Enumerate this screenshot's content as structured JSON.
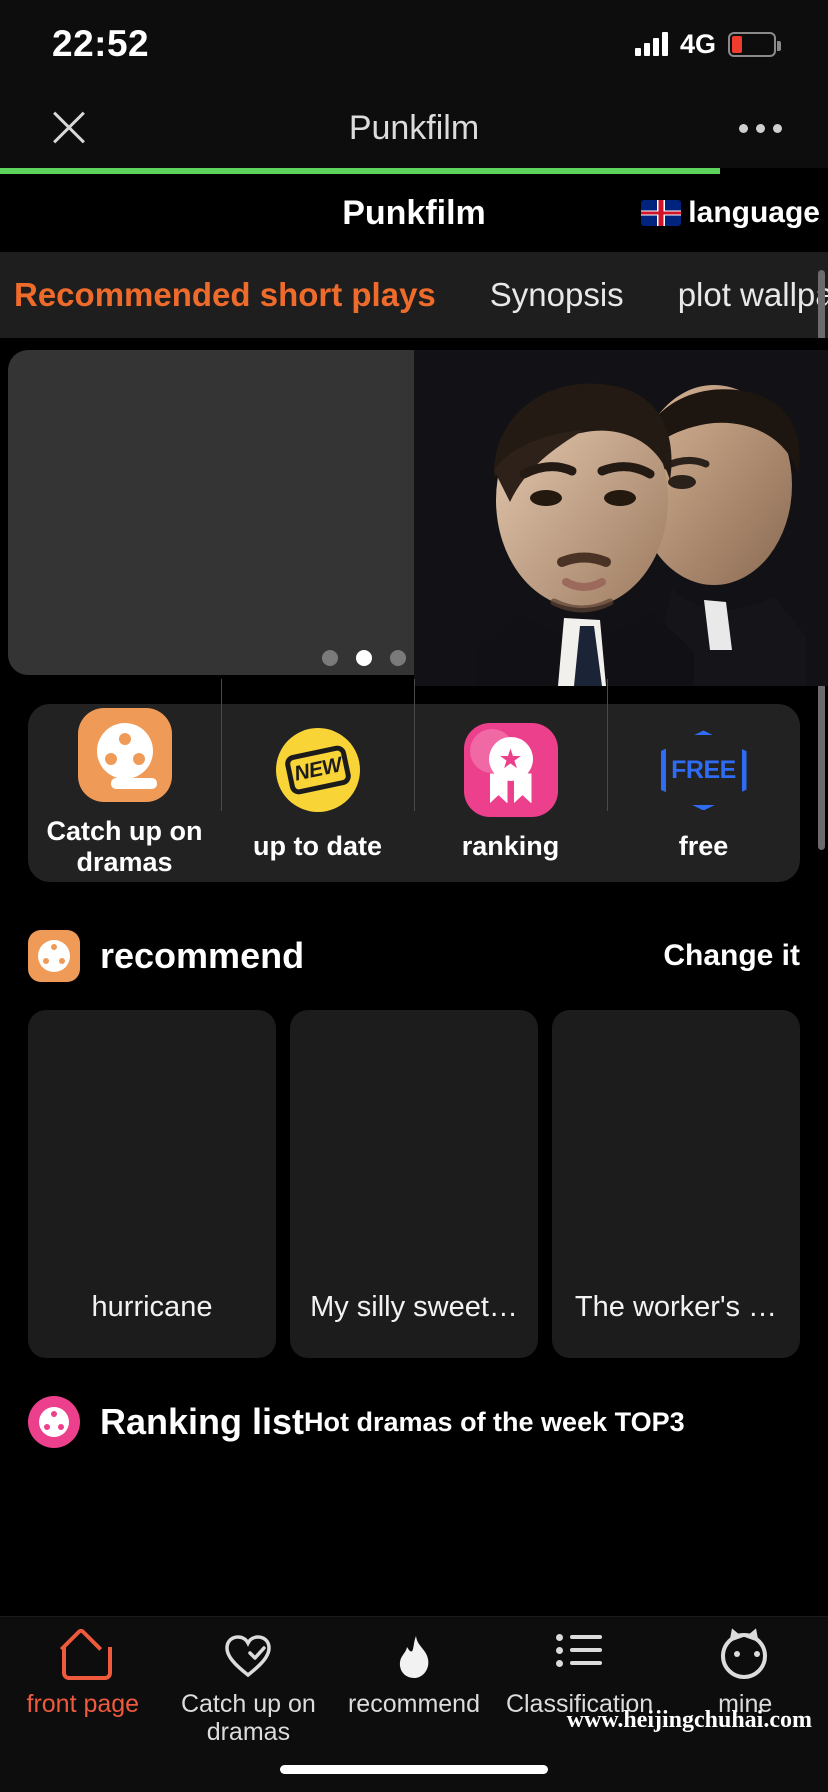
{
  "status_bar": {
    "time": "22:52",
    "network": "4G",
    "signal_icon": "signal-bars-icon",
    "battery_icon": "battery-low-icon",
    "battery_color": "#f03c2e"
  },
  "wechat_nav": {
    "close_icon": "close-icon",
    "title": "Punkfilm",
    "more_icon": "more-options-icon",
    "progress_percent": 87,
    "progress_color": "#5ed45e"
  },
  "app_header": {
    "title": "Punkfilm",
    "language_label": "language",
    "flag_icon": "uk-flag-icon"
  },
  "tabs": {
    "items": [
      {
        "label": "Recommended short plays",
        "active": true
      },
      {
        "label": "Synopsis",
        "active": false
      },
      {
        "label": "plot wallpaper",
        "active": false
      }
    ],
    "active_color": "#ef6b2b"
  },
  "carousel": {
    "dots_total": 3,
    "active_dot": 2,
    "slide_alt": "two-men-in-suits-poster"
  },
  "quick_access": {
    "items": [
      {
        "label": "Catch up on dramas",
        "icon": "film-reel-icon",
        "color": "#ef9a57"
      },
      {
        "label": "up to date",
        "icon": "new-badge-icon",
        "color": "#f9d437"
      },
      {
        "label": "ranking",
        "icon": "medal-icon",
        "color": "#ec3f8c"
      },
      {
        "label": "free",
        "icon": "free-hexagon-icon",
        "color": "#2f6bf3"
      }
    ]
  },
  "recommend_section": {
    "icon": "film-reel-icon",
    "title": "recommend",
    "action_label": "Change it",
    "cards": [
      {
        "title": "hurricane"
      },
      {
        "title": "My silly sweet…"
      },
      {
        "title": "The worker's …"
      }
    ]
  },
  "ranking_section": {
    "icon": "ranking-icon",
    "title": "Ranking list",
    "subtitle": "Hot dramas of the week TOP3"
  },
  "bottom_nav": {
    "items": [
      {
        "label": "front page",
        "icon": "home-icon",
        "active": true
      },
      {
        "label": "Catch up on dramas",
        "icon": "heart-check-icon",
        "active": false
      },
      {
        "label": "recommend",
        "icon": "fire-icon",
        "active": false
      },
      {
        "label": "Classification",
        "icon": "list-icon",
        "active": false
      },
      {
        "label": "mine",
        "icon": "cat-face-icon",
        "active": false
      }
    ],
    "active_color": "#f05a3c"
  },
  "watermark": "www.heijingchuhai.com"
}
